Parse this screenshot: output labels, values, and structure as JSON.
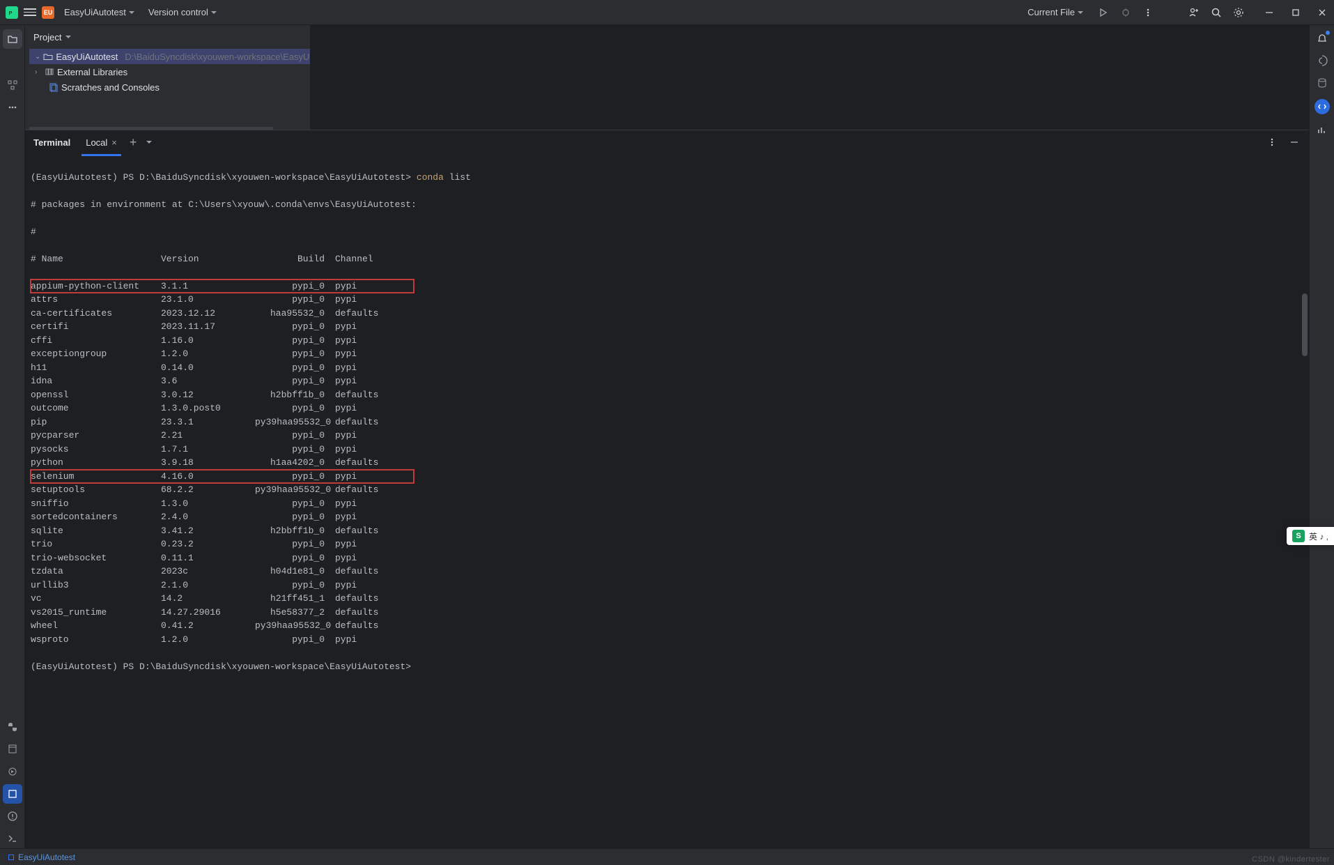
{
  "titlebar": {
    "project_badge": "EU",
    "project_name": "EasyUiAutotest",
    "vcs_label": "Version control",
    "run_config": "Current File"
  },
  "project_panel": {
    "title": "Project",
    "root": {
      "name": "EasyUiAutotest",
      "path": "D:\\BaiduSyncdisk\\xyouwen-workspace\\EasyUi..."
    },
    "external": "External Libraries",
    "scratches": "Scratches and Consoles"
  },
  "terminal": {
    "title": "Terminal",
    "tab": "Local",
    "prompt1_pre": "(EasyUiAutotest) PS D:\\BaiduSyncdisk\\xyouwen-workspace\\EasyUiAutotest> ",
    "cmd_conda": "conda",
    "cmd_list": " list",
    "env_line": "# packages in environment at C:\\Users\\xyouw\\.conda\\envs\\EasyUiAutotest:",
    "hash_line": "#",
    "header": {
      "name": "# Name",
      "version": "Version",
      "build": "Build",
      "channel": "Channel"
    },
    "packages": [
      {
        "n": "appium-python-client",
        "v": "3.1.1",
        "b": "pypi_0",
        "c": "pypi",
        "hl": true
      },
      {
        "n": "attrs",
        "v": "23.1.0",
        "b": "pypi_0",
        "c": "pypi"
      },
      {
        "n": "ca-certificates",
        "v": "2023.12.12",
        "b": "haa95532_0",
        "c": "defaults"
      },
      {
        "n": "certifi",
        "v": "2023.11.17",
        "b": "pypi_0",
        "c": "pypi"
      },
      {
        "n": "cffi",
        "v": "1.16.0",
        "b": "pypi_0",
        "c": "pypi"
      },
      {
        "n": "exceptiongroup",
        "v": "1.2.0",
        "b": "pypi_0",
        "c": "pypi"
      },
      {
        "n": "h11",
        "v": "0.14.0",
        "b": "pypi_0",
        "c": "pypi"
      },
      {
        "n": "idna",
        "v": "3.6",
        "b": "pypi_0",
        "c": "pypi"
      },
      {
        "n": "openssl",
        "v": "3.0.12",
        "b": "h2bbff1b_0",
        "c": "defaults"
      },
      {
        "n": "outcome",
        "v": "1.3.0.post0",
        "b": "pypi_0",
        "c": "pypi"
      },
      {
        "n": "pip",
        "v": "23.3.1",
        "b": "py39haa95532_0",
        "c": "defaults"
      },
      {
        "n": "pycparser",
        "v": "2.21",
        "b": "pypi_0",
        "c": "pypi"
      },
      {
        "n": "pysocks",
        "v": "1.7.1",
        "b": "pypi_0",
        "c": "pypi"
      },
      {
        "n": "python",
        "v": "3.9.18",
        "b": "h1aa4202_0",
        "c": "defaults"
      },
      {
        "n": "selenium",
        "v": "4.16.0",
        "b": "pypi_0",
        "c": "pypi",
        "hl": true
      },
      {
        "n": "setuptools",
        "v": "68.2.2",
        "b": "py39haa95532_0",
        "c": "defaults"
      },
      {
        "n": "sniffio",
        "v": "1.3.0",
        "b": "pypi_0",
        "c": "pypi"
      },
      {
        "n": "sortedcontainers",
        "v": "2.4.0",
        "b": "pypi_0",
        "c": "pypi"
      },
      {
        "n": "sqlite",
        "v": "3.41.2",
        "b": "h2bbff1b_0",
        "c": "defaults"
      },
      {
        "n": "trio",
        "v": "0.23.2",
        "b": "pypi_0",
        "c": "pypi"
      },
      {
        "n": "trio-websocket",
        "v": "0.11.1",
        "b": "pypi_0",
        "c": "pypi"
      },
      {
        "n": "tzdata",
        "v": "2023c",
        "b": "h04d1e81_0",
        "c": "defaults"
      },
      {
        "n": "urllib3",
        "v": "2.1.0",
        "b": "pypi_0",
        "c": "pypi"
      },
      {
        "n": "vc",
        "v": "14.2",
        "b": "h21ff451_1",
        "c": "defaults"
      },
      {
        "n": "vs2015_runtime",
        "v": "14.27.29016",
        "b": "h5e58377_2",
        "c": "defaults"
      },
      {
        "n": "wheel",
        "v": "0.41.2",
        "b": "py39haa95532_0",
        "c": "defaults"
      },
      {
        "n": "wsproto",
        "v": "1.2.0",
        "b": "pypi_0",
        "c": "pypi"
      }
    ],
    "prompt2": "(EasyUiAutotest) PS D:\\BaiduSyncdisk\\xyouwen-workspace\\EasyUiAutotest>"
  },
  "statusbar": {
    "project": "EasyUiAutotest"
  },
  "ime": {
    "badge": "S",
    "text": "英 ♪ ,"
  },
  "watermark": "CSDN @kindertester"
}
